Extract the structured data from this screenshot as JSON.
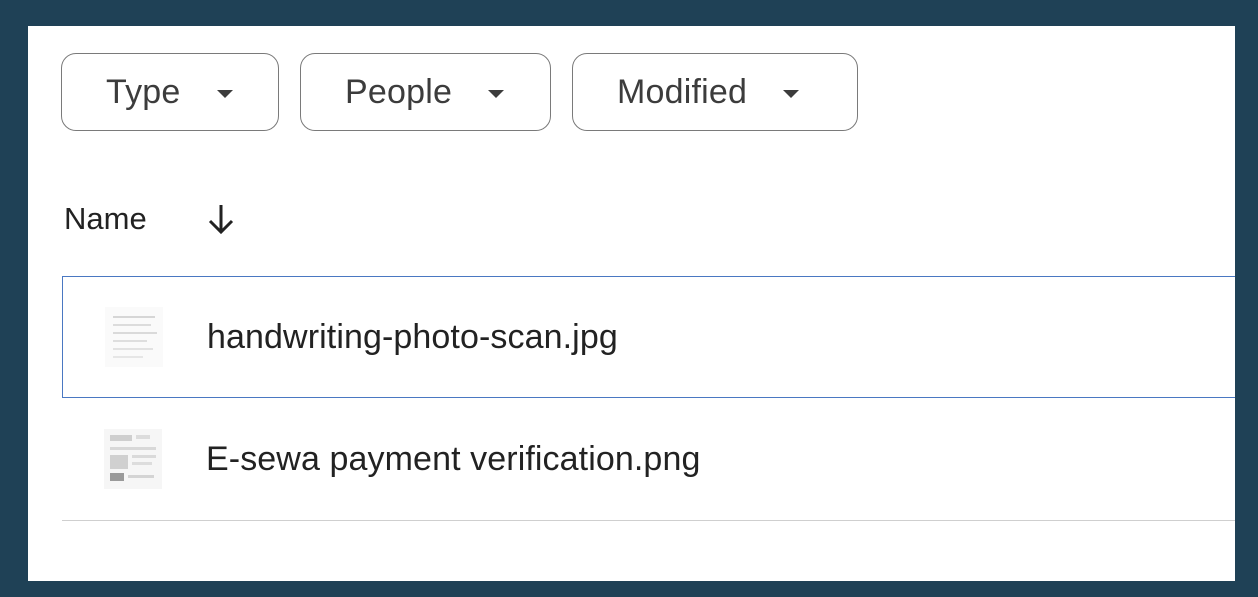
{
  "filters": [
    {
      "label": "Type",
      "icon": "arrow-drop-down-icon"
    },
    {
      "label": "People",
      "icon": "arrow-drop-down-icon"
    },
    {
      "label": "Modified",
      "icon": "arrow-drop-down-icon"
    }
  ],
  "list": {
    "header": {
      "name_label": "Name",
      "sort_icon": "arrow-downward-icon"
    },
    "files": [
      {
        "name": "handwriting-photo-scan.jpg",
        "thumbnail": "document-thumbnail",
        "selected": true
      },
      {
        "name": "E-sewa payment verification.png",
        "thumbnail": "screenshot-thumbnail",
        "selected": false
      }
    ]
  },
  "colors": {
    "frame": "#1f4156",
    "selection_border": "#4a78c2",
    "divider": "#cfcfcf",
    "text": "#222222"
  }
}
